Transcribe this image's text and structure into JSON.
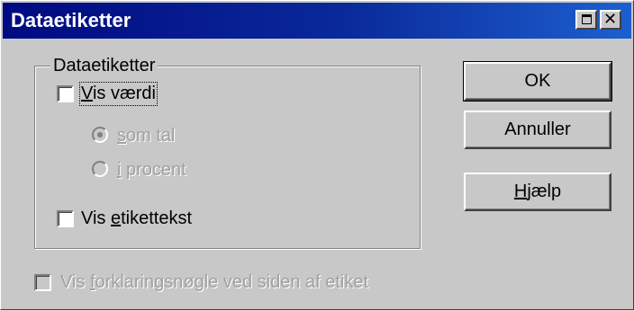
{
  "window": {
    "title": "Dataetiketter"
  },
  "group": {
    "legend": "Dataetiketter",
    "show_value": {
      "label_before": "",
      "mnemonic": "V",
      "label_after": "is værdi",
      "checked": false
    },
    "as_number": {
      "label_before": "",
      "mnemonic": "s",
      "label_after": "om tal",
      "selected": true,
      "enabled": false
    },
    "as_percent": {
      "label_before": "",
      "mnemonic": "i",
      "label_after": " procent",
      "selected": false,
      "enabled": false
    },
    "show_label_text": {
      "label_before": "Vis ",
      "mnemonic": "e",
      "label_after": "tikettekst",
      "checked": false
    }
  },
  "legend_key": {
    "label_before": "Vis ",
    "mnemonic": "f",
    "label_after": "orklaringsnøgle ved siden af etiket",
    "checked": false,
    "enabled": false
  },
  "buttons": {
    "ok": {
      "label_before": "OK",
      "mnemonic": "",
      "label_after": ""
    },
    "cancel": {
      "label_before": "Annuller",
      "mnemonic": "",
      "label_after": ""
    },
    "help": {
      "label_before": "",
      "mnemonic": "H",
      "label_after": "jælp"
    }
  },
  "icons": {
    "maximize": "maximize-icon",
    "close": "close-icon"
  }
}
